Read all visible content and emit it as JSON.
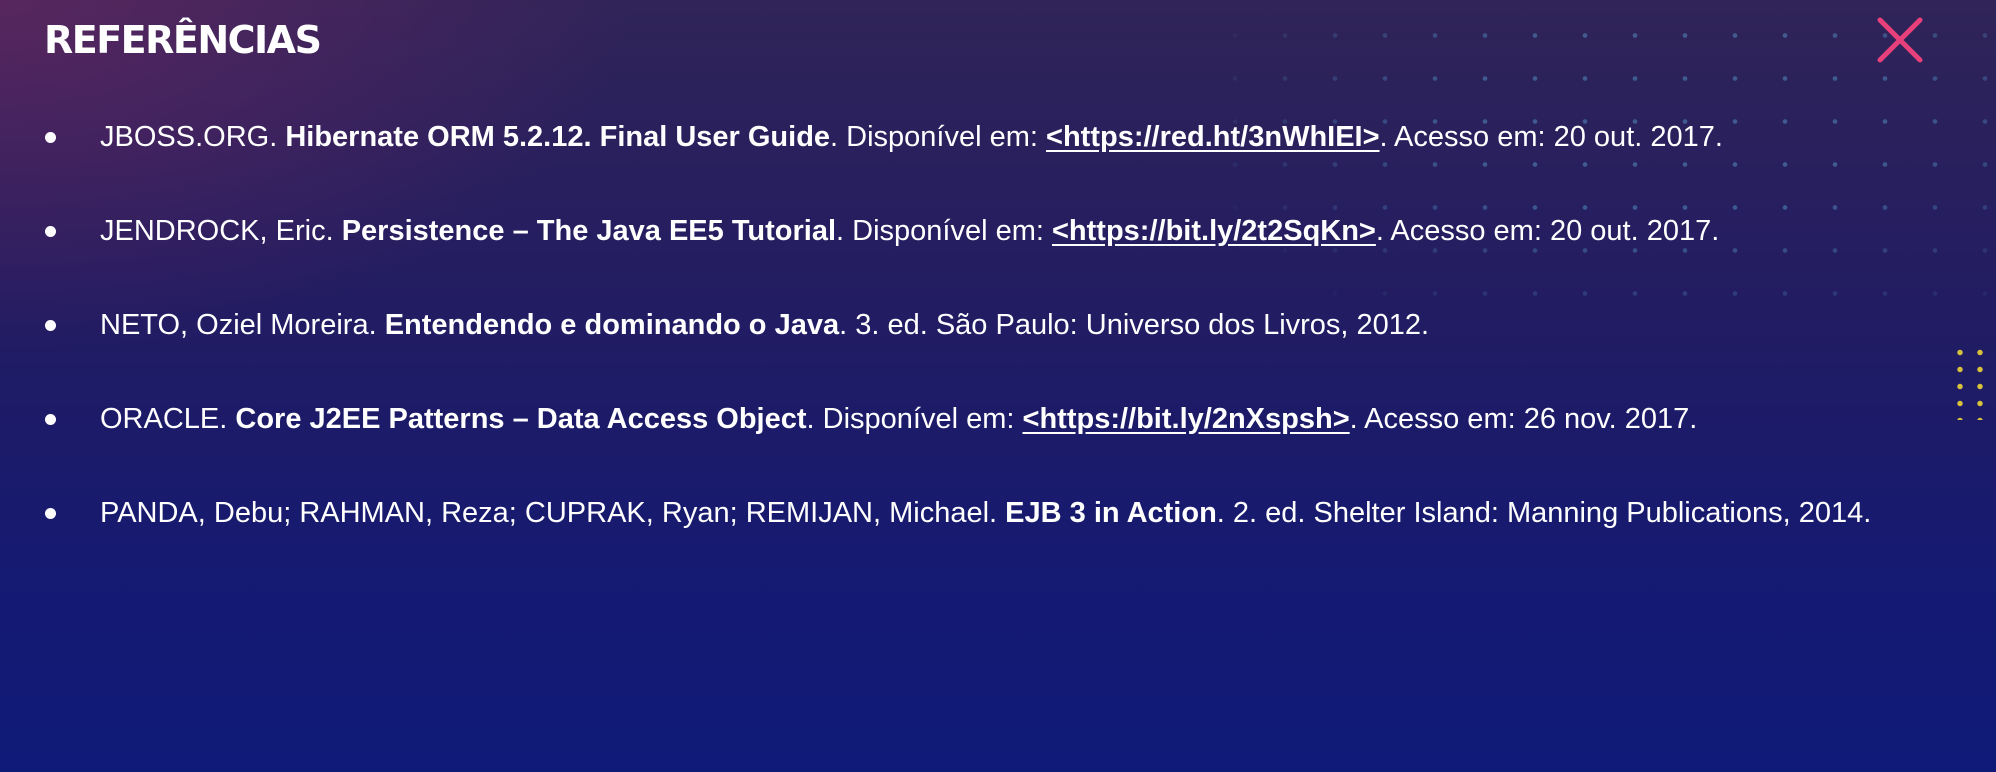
{
  "header": {
    "title": "REFERÊNCIAS",
    "close_icon": "close-x-icon"
  },
  "colors": {
    "accent": "#e8407a",
    "background_top": "#302458",
    "background_bottom": "#0f1a78",
    "dot_pattern": "#508cbe",
    "yellow_dots": "#d8c23a"
  },
  "references": [
    {
      "author": "JBOSS.ORG.",
      "title": "Hibernate ORM 5.2.12. Final User Guide",
      "after_title": ". Disponível em: ",
      "link": "<https://red.ht/3nWhIEI>",
      "after_link": ". Acesso em: 20 out. 2017."
    },
    {
      "author": "JENDROCK, Eric.",
      "title": "Persistence – The Java EE5 Tutorial",
      "after_title": ". Disponível em: ",
      "link": "<https://bit.ly/2t2SqKn>",
      "after_link": ". Acesso em: 20 out. 2017."
    },
    {
      "author": "NETO, Oziel Moreira.",
      "title": "Entendendo e dominando o Java",
      "after_title": ". 3. ed. São Paulo: Universo dos Livros, 2012.",
      "link": "",
      "after_link": ""
    },
    {
      "author": "ORACLE.",
      "title": "Core J2EE Patterns – Data Access Object",
      "after_title": ". Disponível em: ",
      "link": "<https://bit.ly/2nXspsh>",
      "after_link": ". Acesso em: 26 nov. 2017."
    },
    {
      "author": "PANDA, Debu; RAHMAN, Reza; CUPRAK, Ryan; REMIJAN, Michael.",
      "title": "EJB 3 in Action",
      "after_title": ". 2. ed. Shelter Island: Manning Publications, 2014.",
      "link": "",
      "after_link": ""
    }
  ]
}
